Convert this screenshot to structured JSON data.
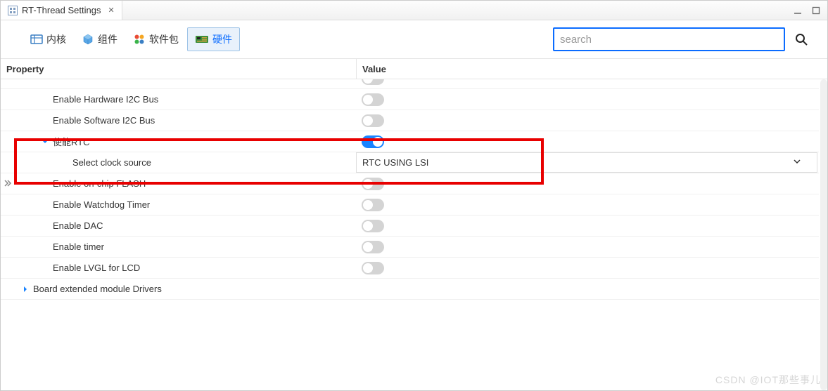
{
  "title": "RT-Thread Settings",
  "nav": [
    {
      "label": "内核"
    },
    {
      "label": "组件"
    },
    {
      "label": "软件包"
    },
    {
      "label": "硬件",
      "active": true
    }
  ],
  "search": {
    "placeholder": "search"
  },
  "columns": {
    "property": "Property",
    "value": "Value"
  },
  "rows": [
    {
      "label": "Enable Hardware I2C Bus",
      "indent": 4,
      "marker": "none",
      "type": "toggle",
      "on": false
    },
    {
      "label": "Enable Software I2C Bus",
      "indent": 4,
      "marker": "none",
      "type": "toggle",
      "on": false
    },
    {
      "label": "使能RTC",
      "indent": 4,
      "marker": "down",
      "type": "toggle",
      "on": true
    },
    {
      "label": "Select clock source",
      "indent": 6,
      "marker": "none",
      "type": "dropdown",
      "value": "RTC USING LSI"
    },
    {
      "label": "Enable on-chip FLASH",
      "indent": 4,
      "marker": "none",
      "type": "toggle",
      "on": false
    },
    {
      "label": "Enable Watchdog Timer",
      "indent": 4,
      "marker": "none",
      "type": "toggle",
      "on": false
    },
    {
      "label": "Enable DAC",
      "indent": 4,
      "marker": "none",
      "type": "toggle",
      "on": false
    },
    {
      "label": "Enable timer",
      "indent": 4,
      "marker": "none",
      "type": "toggle",
      "on": false
    },
    {
      "label": "Enable LVGL for LCD",
      "indent": 4,
      "marker": "none",
      "type": "toggle",
      "on": false
    },
    {
      "label": "Board extended module Drivers",
      "indent": 2,
      "marker": "right",
      "type": "none"
    }
  ],
  "toggle_peek": {
    "indent": 4,
    "on": false
  },
  "watermark": "CSDN @IOT那些事儿"
}
